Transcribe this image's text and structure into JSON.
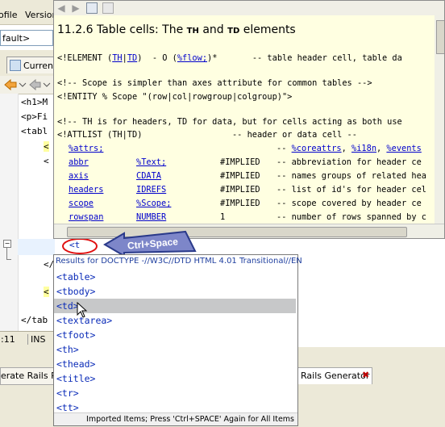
{
  "ide": {
    "menu": [
      "ofile",
      "Version"
    ],
    "config_combo": "fault>",
    "current_tab": "Curren",
    "code_lines": [
      "<h1>M",
      "<p>Fi",
      "<tabl",
      "<",
      "<",
      "</",
      "<",
      "</tab"
    ],
    "typed_text": "<t",
    "status": {
      "position": ":11",
      "mode": "INS"
    },
    "lower_tabs": {
      "left": "erate Rails Pro",
      "right": "Rails Generator"
    }
  },
  "doc": {
    "title_prefix": "11.2.6 Table cells: The ",
    "title_th": "TH",
    "title_and": " and ",
    "title_td": "TD",
    "title_suffix": " elements",
    "elem_line": {
      "a": "<!ELEMENT (",
      "th": "TH",
      "bar": "|",
      "td": "TD",
      "b": ")  - O (",
      "flow": "%flow;",
      "c": ")*       -- table header cell, table da"
    },
    "scope_comment": "<!-- Scope is simpler than axes attribute for common tables -->",
    "entity_scope": "<!ENTITY % Scope \"(row|col|rowgroup|colgroup)\">",
    "th_comment": "<!-- TH is for headers, TD for data, but for cells acting as both use",
    "attlist": "<!ATTLIST (TH|TD)                  -- header or data cell --",
    "attrs_row": {
      "name": "%attrs;",
      "dash": "-- ",
      "core": "%coreattrs",
      "sep1": ", ",
      "i18n": "%i18n",
      "sep2": ", ",
      "events": "%events"
    },
    "attr_rows": [
      {
        "name": "abbr",
        "type": "%Text;",
        "default": "#IMPLIED",
        "desc": "-- abbreviation for header ce"
      },
      {
        "name": "axis",
        "type": "CDATA",
        "default": "#IMPLIED",
        "desc": "-- names groups of related hea"
      },
      {
        "name": "headers",
        "type": "IDREFS",
        "default": "#IMPLIED",
        "desc": "-- list of id's for header cel"
      },
      {
        "name": "scope",
        "type": "%Scope;",
        "default": "#IMPLIED",
        "desc": "-- scope covered by header ce"
      },
      {
        "name": "rowspan",
        "type": "NUMBER",
        "default": "1",
        "desc": "-- number of rows spanned by c"
      }
    ]
  },
  "completion": {
    "header": "Results for DOCTYPE -//W3C//DTD HTML 4.01 Transitional//EN",
    "items": [
      "<table>",
      "<tbody>",
      "<td>",
      "<textarea>",
      "<tfoot>",
      "<th>",
      "<thead>",
      "<title>",
      "<tr>",
      "<tt>"
    ],
    "selected_index": 2,
    "footer": "Imported Items; Press 'Ctrl+SPACE' Again for All Items"
  },
  "callout": {
    "label": "Ctrl+Space"
  },
  "colors": {
    "accent_blue": "#0a2bb8",
    "callout_fill": "#7d86c9",
    "callout_stroke": "#2a3a8a",
    "circle_red": "#e01010",
    "doc_bg": "#ffffe1"
  }
}
